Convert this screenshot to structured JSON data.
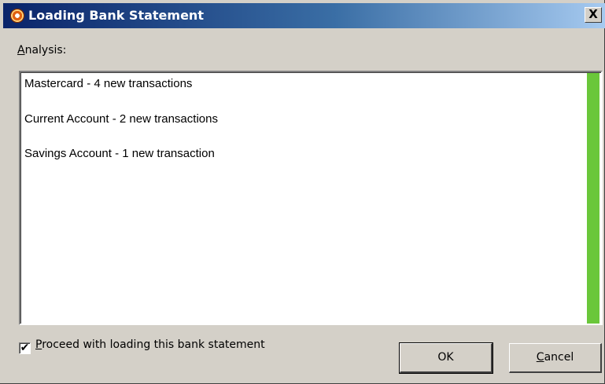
{
  "window": {
    "title": "Loading Bank Statement",
    "close_label": "X"
  },
  "analysis": {
    "label_accel": "A",
    "label_rest": "nalysis:",
    "items": [
      "Mastercard - 4 new transactions",
      "Current Account - 2 new transactions",
      "Savings Account - 1 new transaction"
    ],
    "progress_fraction": 1.0,
    "progress_color": "#6ac73a"
  },
  "proceed": {
    "checked": true,
    "check_mark": "✔",
    "label_accel": "P",
    "label_rest": "roceed with loading this bank statement"
  },
  "buttons": {
    "ok_label": "OK",
    "cancel_accel": "C",
    "cancel_rest": "ancel"
  },
  "colors": {
    "title_gradient_start": "#0a246a",
    "title_gradient_end": "#a6caf0",
    "dialog_bg": "#d4d0c8"
  }
}
